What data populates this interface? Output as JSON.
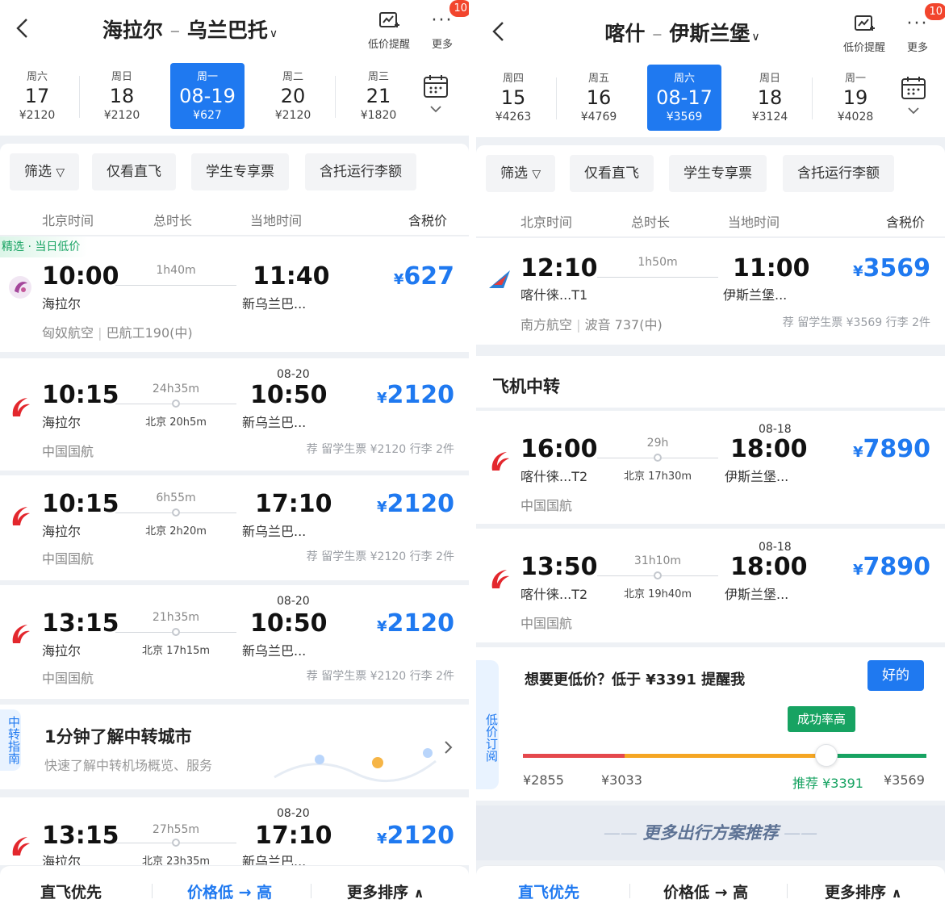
{
  "left": {
    "route": {
      "from": "海拉尔",
      "to": "乌兰巴托",
      "dash": "–"
    },
    "tools": {
      "alert_label": "低价提醒",
      "more_label": "更多",
      "badge": "10"
    },
    "dates": [
      {
        "weekday": "周六",
        "day": "17",
        "price": "¥2120"
      },
      {
        "weekday": "周日",
        "day": "18",
        "price": "¥2120"
      },
      {
        "weekday": "周一",
        "day": "08-19",
        "price": "¥627",
        "selected": true
      },
      {
        "weekday": "周二",
        "day": "20",
        "price": "¥2120"
      },
      {
        "weekday": "周三",
        "day": "21",
        "price": "¥1820"
      }
    ],
    "filters": [
      "筛选",
      "仅看直飞",
      "学生专享票",
      "含托运行李额"
    ],
    "columns": {
      "dep": "北京时间",
      "dur": "总时长",
      "arr": "当地时间",
      "price": "含税价"
    },
    "tag": "精选 · 当日低价",
    "flights": [
      {
        "dep": "10:00",
        "dep_ap": "海拉尔",
        "dur": "1h40m",
        "via": "",
        "next_day": "",
        "arr": "11:40",
        "arr_ap": "新乌兰巴...",
        "price": "627",
        "airline": "匈奴航空",
        "plane": "巴航工190(中)",
        "note": "",
        "logo": "mongolian"
      },
      {
        "dep": "10:15",
        "dep_ap": "海拉尔",
        "dur": "24h35m",
        "via": "北京 20h5m",
        "next_day": "08-20",
        "arr": "10:50",
        "arr_ap": "新乌兰巴...",
        "price": "2120",
        "airline": "中国国航",
        "plane": "",
        "note": "荐 留学生票 ¥2120 行李 2件",
        "logo": "airchina"
      },
      {
        "dep": "10:15",
        "dep_ap": "海拉尔",
        "dur": "6h55m",
        "via": "北京 2h20m",
        "next_day": "",
        "arr": "17:10",
        "arr_ap": "新乌兰巴...",
        "price": "2120",
        "airline": "中国国航",
        "plane": "",
        "note": "荐 留学生票 ¥2120 行李 2件",
        "logo": "airchina"
      },
      {
        "dep": "13:15",
        "dep_ap": "海拉尔",
        "dur": "21h35m",
        "via": "北京 17h15m",
        "next_day": "08-20",
        "arr": "10:50",
        "arr_ap": "新乌兰巴...",
        "price": "2120",
        "airline": "中国国航",
        "plane": "",
        "note": "荐 留学生票 ¥2120 行李 2件",
        "logo": "airchina"
      }
    ],
    "guide": {
      "vlabel": "中转指南",
      "title": "1分钟了解中转城市",
      "subtitle": "快速了解中转机场概览、服务"
    },
    "last_flight": {
      "dep": "13:15",
      "dep_ap": "海拉尔",
      "dur": "27h55m",
      "via": "北京 23h35m",
      "next_day": "08-20",
      "arr": "17:10",
      "arr_ap": "新乌兰巴...",
      "price": "2120"
    },
    "sort": {
      "direct": "直飞优先",
      "price": "价格低 → 高",
      "more": "更多排序"
    }
  },
  "right": {
    "route": {
      "from": "喀什",
      "to": "伊斯兰堡",
      "dash": "–"
    },
    "tools": {
      "alert_label": "低价提醒",
      "more_label": "更多",
      "badge": "10"
    },
    "dates": [
      {
        "weekday": "周四",
        "day": "15",
        "price": "¥4263"
      },
      {
        "weekday": "周五",
        "day": "16",
        "price": "¥4769"
      },
      {
        "weekday": "周六",
        "day": "08-17",
        "price": "¥3569",
        "selected": true
      },
      {
        "weekday": "周日",
        "day": "18",
        "price": "¥3124"
      },
      {
        "weekday": "周一",
        "day": "19",
        "price": "¥4028"
      }
    ],
    "filters": [
      "筛选",
      "仅看直飞",
      "学生专享票",
      "含托运行李额"
    ],
    "columns": {
      "dep": "北京时间",
      "dur": "总时长",
      "arr": "当地时间",
      "price": "含税价"
    },
    "direct_flight": {
      "dep": "12:10",
      "dep_ap": "喀什徕...T1",
      "dur": "1h50m",
      "arr": "11:00",
      "arr_ap": "伊斯兰堡...",
      "price": "3569",
      "airline": "南方航空",
      "plane": "波音 737(中)",
      "note": "荐 留学生票 ¥3569 行李 2件"
    },
    "section_title": "飞机中转",
    "connect_flights": [
      {
        "dep": "16:00",
        "dep_ap": "喀什徕...T2",
        "dur": "29h",
        "via": "北京 17h30m",
        "next_day": "08-18",
        "arr": "18:00",
        "arr_ap": "伊斯兰堡...",
        "price": "7890",
        "airline": "中国国航"
      },
      {
        "dep": "13:50",
        "dep_ap": "喀什徕...T2",
        "dur": "31h10m",
        "via": "北京 19h40m",
        "next_day": "08-18",
        "arr": "18:00",
        "arr_ap": "伊斯兰堡...",
        "price": "7890",
        "airline": "中国国航"
      }
    ],
    "subscribe": {
      "vlabel": "低价订阅",
      "question": "想要更低价？低于 ¥3391 提醒我",
      "ok": "好的",
      "pill": "成功率高",
      "min": "¥2855",
      "p2": "¥3033",
      "recommend": "推荐 ¥3391",
      "max": "¥3569"
    },
    "more_plans": "更多出行方案推荐",
    "sort": {
      "direct": "直飞优先",
      "price": "价格低 → 高",
      "more": "更多排序"
    }
  }
}
